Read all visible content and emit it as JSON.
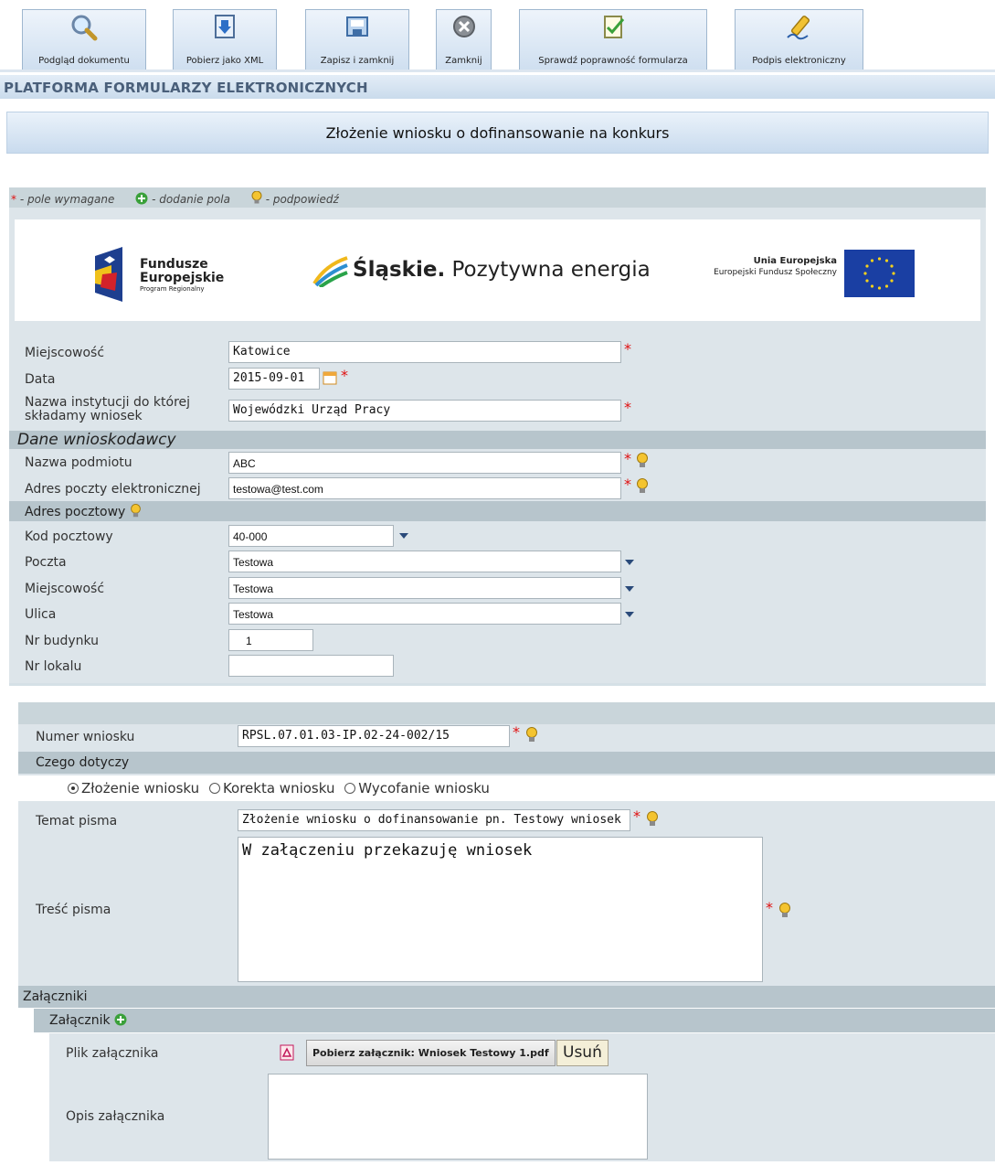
{
  "toolbar": {
    "buttons": [
      {
        "label": "Podgląd dokumentu",
        "icon": "magnifier-icon"
      },
      {
        "label": "Pobierz jako XML",
        "icon": "download-icon"
      },
      {
        "label": "Zapisz i zamknij",
        "icon": "save-close-icon"
      },
      {
        "label": "Zamknij",
        "icon": "close-icon"
      },
      {
        "label": "Sprawdź poprawność formularza",
        "icon": "check-form-icon"
      },
      {
        "label": "Podpis elektroniczny",
        "icon": "signature-pen-icon"
      }
    ]
  },
  "platform_title": "PLATFORMA FORMULARZY ELEKTRONICZNYCH",
  "form_title": "Złożenie wniosku o dofinansowanie na konkurs",
  "legend": {
    "required": "- pole wymagane",
    "add_field": "- dodanie pola",
    "hint": "- podpowiedź",
    "star": "*"
  },
  "logos": {
    "fe_line1": "Fundusze",
    "fe_line2": "Europejskie",
    "fe_line3": "Program Regionalny",
    "slaskie_bold": "Śląskie.",
    "slaskie_rest": " Pozytywna energia",
    "ue_line1": "Unia Europejska",
    "ue_line2": "Europejski Fundusz Społeczny"
  },
  "fields": {
    "miejscowosc": {
      "label": "Miejscowość",
      "value": "Katowice"
    },
    "data": {
      "label": "Data",
      "value": "2015-09-01"
    },
    "instytucja": {
      "label_line1": "Nazwa instytucji do której",
      "label_line2": "składamy wniosek",
      "value": "Wojewódzki Urząd Pracy"
    }
  },
  "wnioskodawca": {
    "heading": "Dane wnioskodawcy",
    "nazwa": {
      "label": "Nazwa podmiotu",
      "value": "ABC"
    },
    "email": {
      "label": "Adres poczty elektronicznej",
      "value": "testowa@test.com"
    }
  },
  "adres": {
    "heading": "Adres pocztowy",
    "kod": {
      "label": "Kod pocztowy",
      "value": "40-000"
    },
    "poczta": {
      "label": "Poczta",
      "value": "Testowa"
    },
    "miejscowosc": {
      "label": "Miejscowość",
      "value": "Testowa"
    },
    "ulica": {
      "label": "Ulica",
      "value": "Testowa"
    },
    "nr_budynku": {
      "label": "Nr budynku",
      "value": "1"
    },
    "nr_lokalu": {
      "label": "Nr lokalu",
      "value": ""
    }
  },
  "wniosek": {
    "numer": {
      "label": "Numer wniosku",
      "value": "RPSL.07.01.03-IP.02-24-002/15"
    },
    "czego_dotyczy": "Czego dotyczy",
    "options": [
      "Złożenie wniosku",
      "Korekta wniosku",
      "Wycofanie wniosku"
    ],
    "selected": "Złożenie wniosku",
    "temat": {
      "label": "Temat pisma",
      "value": "Złożenie wniosku o dofinansowanie pn. Testowy wniosek"
    },
    "tresc": {
      "label": "Treść pisma",
      "value": "W załączeniu przekazuję wniosek"
    }
  },
  "zalaczniki": {
    "heading": "Załączniki",
    "sub_heading": "Załącznik",
    "plik_label": "Plik załącznika",
    "download_label": "Pobierz załącznik: Wniosek Testowy 1.pdf",
    "remove_label": "Usuń",
    "opis_label": "Opis załącznika",
    "opis_value": ""
  },
  "colors": {
    "required": "#e01010",
    "panel": "#dde5ea",
    "section": "#b7c5cc",
    "header_text": "#4a5f7a"
  }
}
